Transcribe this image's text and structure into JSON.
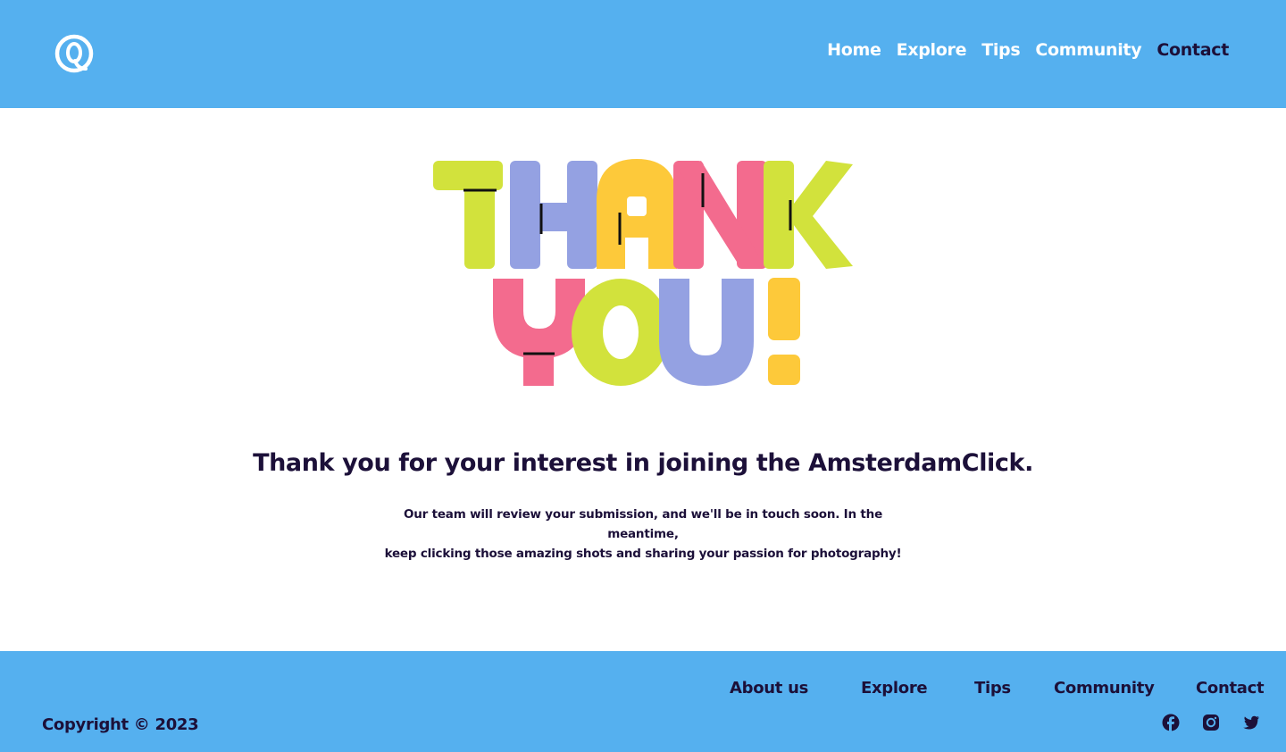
{
  "header": {
    "logo_icon": "at-sign-logo-icon",
    "nav": [
      {
        "label": "Home"
      },
      {
        "label": "Explore"
      },
      {
        "label": "Tips"
      },
      {
        "label": "Community"
      },
      {
        "label": "Contact"
      }
    ],
    "active_item": "Contact"
  },
  "hero": {
    "image_text": "THANK YOU!",
    "colors": {
      "lime": "#d2e23c",
      "periwinkle": "#94a1e2",
      "yellow": "#fdc93a",
      "pink": "#f36b8e"
    }
  },
  "main": {
    "headline": "Thank you for your interest in joining the AmsterdamClick.",
    "body_line1": "Our team will review your submission, and we'll be in touch soon. In the meantime,",
    "body_line2": "keep clicking those amazing shots and sharing your passion for photography!"
  },
  "footer": {
    "links": [
      {
        "label": "About us"
      },
      {
        "label": "Explore"
      },
      {
        "label": "Tips"
      },
      {
        "label": "Community"
      },
      {
        "label": "Contact"
      }
    ],
    "copyright": "Copyright © 2023",
    "social_icons": [
      "facebook-icon",
      "instagram-icon",
      "twitter-icon"
    ]
  },
  "theme": {
    "brand_blue": "#55b0ef",
    "text_dark": "#1c1039",
    "white": "#ffffff"
  }
}
